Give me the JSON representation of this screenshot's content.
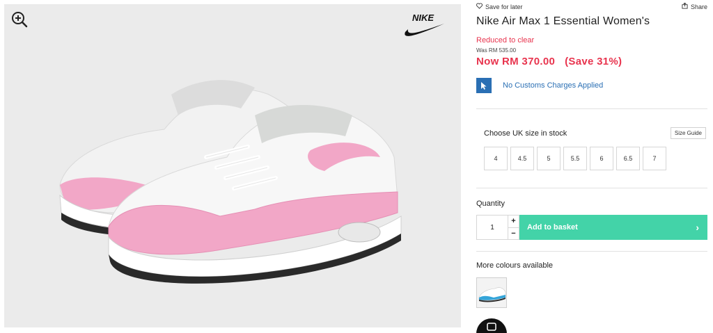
{
  "topbar": {
    "save_for_later": "Save for later",
    "share": "Share"
  },
  "product": {
    "title": "Nike Air Max 1 Essential Women's",
    "reduced_label": "Reduced to clear",
    "was_price": "Was RM 535.00",
    "now_price": "Now RM 370.00",
    "save_text": "(Save 31%)",
    "customs_text": "No Customs Charges Applied"
  },
  "sizes": {
    "header": "Choose UK size in stock",
    "guide_label": "Size Guide",
    "options": [
      "4",
      "4.5",
      "5",
      "5.5",
      "6",
      "6.5",
      "7"
    ]
  },
  "quantity": {
    "label": "Quantity",
    "value": "1",
    "plus": "+",
    "minus": "−"
  },
  "basket": {
    "label": "Add to basket",
    "arrow": "›"
  },
  "colours": {
    "label": "More colours available"
  },
  "icons": {
    "zoom": "zoom-in-icon",
    "heart": "heart-icon",
    "share": "share-icon",
    "cursor": "cursor-icon",
    "brand": "nike-swoosh-logo",
    "chat": "chat-icon"
  },
  "colors": {
    "accent_red": "#e8344e",
    "customs_blue": "#2a6fb4",
    "basket_green": "#43d3a8"
  }
}
